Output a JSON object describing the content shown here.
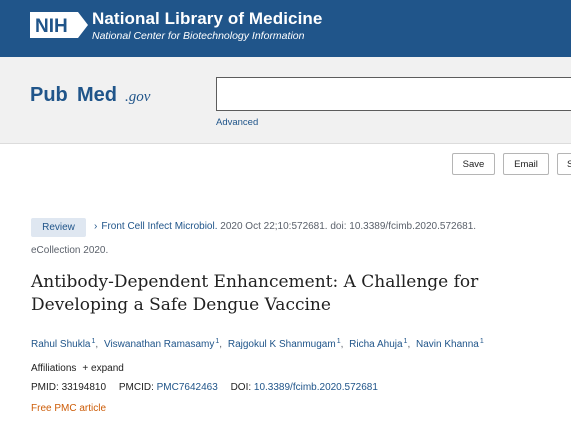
{
  "header": {
    "logo_text": "NIH",
    "title": "National Library of Medicine",
    "subtitle": "National Center for Biotechnology Information"
  },
  "search": {
    "logo_pub": "Pub",
    "logo_med": "Med",
    "logo_gov": ".gov",
    "query": "",
    "advanced_label": "Advanced"
  },
  "actions": {
    "save_label": "Save",
    "email_label": "Email",
    "more_label": "S"
  },
  "article": {
    "type_badge": "Review",
    "journal": "Front Cell Infect Microbiol.",
    "citation_rest": " 2020 Oct 22;10:572681. doi: 10.3389/fcimb.2020.572681.",
    "ecollection": "eCollection 2020.",
    "title": "Antibody-Dependent Enhancement: A Challenge for Developing a Safe Dengue Vaccine",
    "authors": [
      {
        "name": "Rahul Shukla",
        "aff": "1"
      },
      {
        "name": "Viswanathan Ramasamy",
        "aff": "1"
      },
      {
        "name": "Rajgokul K Shanmugam",
        "aff": "1"
      },
      {
        "name": "Richa Ahuja",
        "aff": "1"
      },
      {
        "name": "Navin Khanna",
        "aff": "1"
      }
    ],
    "affiliations_label": "Affiliations",
    "expand_label": "+ expand",
    "pmid_label": "PMID:",
    "pmid": "33194810",
    "pmcid_label": "PMCID:",
    "pmcid": "PMC7642463",
    "doi_label": "DOI:",
    "doi": "10.3389/fcimb.2020.572681",
    "free_label": "Free PMC article"
  },
  "colors": {
    "nih_blue": "#20558a",
    "free_orange": "#cd5c07"
  }
}
